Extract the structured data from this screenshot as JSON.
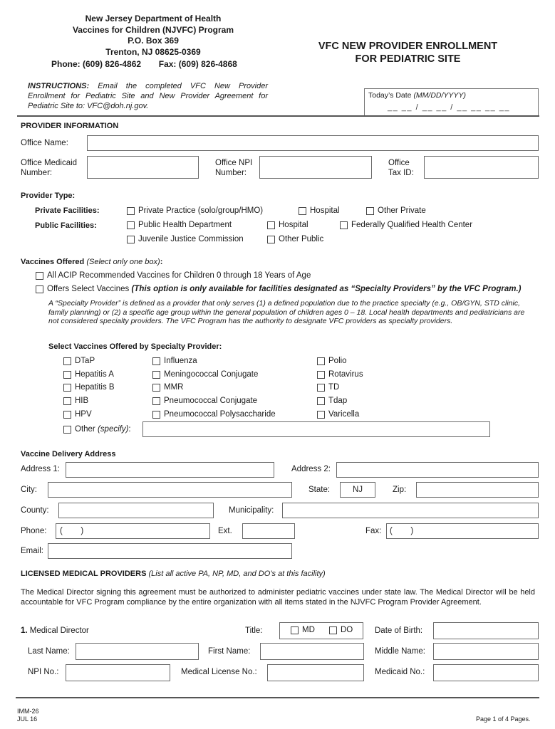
{
  "header": {
    "org_lines": [
      "New Jersey Department of Health",
      "Vaccines for Children (NJVFC) Program",
      "P.O. Box 369",
      "Trenton, NJ 08625-0369"
    ],
    "phone": "Phone: (609) 826-4862",
    "fax": "Fax: (609) 826-4868",
    "form_title_line1": "VFC NEW PROVIDER ENROLLMENT",
    "form_title_line2": "FOR PEDIATRIC SITE",
    "instructions_label": "INSTRUCTIONS:",
    "instructions_text": "Email the completed VFC New Provider Enrollment for Pediatric Site and New Provider Agreement for Pediatric Site to: VFC@doh.nj.gov.",
    "date_label": "Today’s Date",
    "date_format": "(MM/DD/YYYY)",
    "date_blank": "__ __ / __ __ / __ __ __ __"
  },
  "provider_information": {
    "section_title": "PROVIDER INFORMATION",
    "office_name_label": "Office Name:",
    "office_name_value": "",
    "medicaid_label_1": "Office Medicaid",
    "medicaid_label_2": "Number:",
    "medicaid_value": "",
    "npi_label_1": "Office NPI",
    "npi_label_2": "Number:",
    "npi_value": "",
    "taxid_label_1": "Office",
    "taxid_label_2": "Tax ID:",
    "taxid_value": ""
  },
  "provider_type": {
    "title": "Provider Type:",
    "private_label": "Private Facilities:",
    "private_options": [
      {
        "label": "Private Practice (solo/group/HMO)",
        "checked": false
      },
      {
        "label": "Hospital",
        "checked": false
      },
      {
        "label": "Other Private",
        "checked": false
      }
    ],
    "public_label": "Public Facilities:",
    "public_options": [
      {
        "label": "Public Health Department",
        "checked": false
      },
      {
        "label": "Hospital",
        "checked": false
      },
      {
        "label": "Federally Qualified Health Center",
        "checked": false
      },
      {
        "label": "Juvenile Justice Commission",
        "checked": false
      },
      {
        "label": "Other Public",
        "checked": false
      }
    ]
  },
  "vaccines_offered": {
    "title": "Vaccines Offered",
    "title_note": "(Select only one box)",
    "title_colon": ":",
    "option_all": {
      "label": "All ACIP Recommended Vaccines for Children 0 through 18 Years of Age",
      "checked": false
    },
    "option_select": {
      "label": "Offers Select Vaccines",
      "note": "(This option is only available for facilities designated as “Specialty Providers” by the VFC Program.)",
      "checked": false
    },
    "specialty_definition": "A “Specialty Provider” is defined as a provider that only serves (1) a defined population due to the practice specialty (e.g., OB/GYN, STD clinic, family planning) or (2) a specific age group within the general population of children ages 0 – 18.  Local health departments and pediatricians are not considered specialty providers.  The VFC Program has the authority to designate VFC providers as specialty providers.",
    "select_title": "Select Vaccines Offered by Specialty Provider:",
    "col1": [
      {
        "label": "DTaP",
        "checked": false
      },
      {
        "label": "Hepatitis A",
        "checked": false
      },
      {
        "label": "Hepatitis B",
        "checked": false
      },
      {
        "label": "HIB",
        "checked": false
      },
      {
        "label": "HPV",
        "checked": false
      }
    ],
    "col2": [
      {
        "label": "Influenza",
        "checked": false
      },
      {
        "label": "Meningococcal Conjugate",
        "checked": false
      },
      {
        "label": "MMR",
        "checked": false
      },
      {
        "label": "Pneumococcal Conjugate",
        "checked": false
      },
      {
        "label": "Pneumococcal Polysaccharide",
        "checked": false
      }
    ],
    "col3": [
      {
        "label": "Polio",
        "checked": false
      },
      {
        "label": "Rotavirus",
        "checked": false
      },
      {
        "label": "TD",
        "checked": false
      },
      {
        "label": "Tdap",
        "checked": false
      },
      {
        "label": "Varicella",
        "checked": false
      }
    ],
    "other_label": "Other",
    "other_note": "(specify)",
    "other_colon": ":",
    "other_value": ""
  },
  "delivery_address": {
    "title": "Vaccine Delivery Address",
    "address1_label": "Address 1:",
    "address1_value": "",
    "address2_label": "Address 2:",
    "address2_value": "",
    "city_label": "City:",
    "city_value": "",
    "state_label": "State:",
    "state_value": "NJ",
    "zip_label": "Zip:",
    "zip_value": "",
    "county_label": "County:",
    "county_value": "",
    "municipality_label": "Municipality:",
    "municipality_value": "",
    "phone_label": "Phone:",
    "phone_value": "(        )",
    "ext_label": "Ext.",
    "ext_value": "",
    "fax_label": "Fax:",
    "fax_value": "(        )",
    "email_label": "Email:",
    "email_value": ""
  },
  "licensed_providers": {
    "title": "LICENSED MEDICAL PROVIDERS",
    "title_note": "(List all active PA, NP, MD, and DO’s at this facility)",
    "paragraph": "The Medical Director signing this agreement must be authorized to administer pediatric vaccines under state law.  The Medical Director will be held accountable for VFC Program compliance by the entire organization with all items stated in the NJVFC Program Provider Agreement.",
    "director_number": "1.",
    "director_label": "Medical Director",
    "title_label": "Title:",
    "title_options": [
      {
        "label": "MD",
        "checked": false
      },
      {
        "label": "DO",
        "checked": false
      }
    ],
    "dob_label": "Date of Birth:",
    "dob_value": "",
    "last_name_label": "Last Name:",
    "last_name_value": "",
    "first_name_label": "First Name:",
    "first_name_value": "",
    "middle_name_label": "Middle Name:",
    "middle_name_value": "",
    "npi_label": "NPI No.:",
    "npi_value": "",
    "license_label": "Medical License No.:",
    "license_value": "",
    "medicaid_label": "Medicaid No.:",
    "medicaid_value": ""
  },
  "footer": {
    "form_id": "IMM-26",
    "revision": "JUL 16",
    "page": "Page 1 of 4 Pages."
  }
}
